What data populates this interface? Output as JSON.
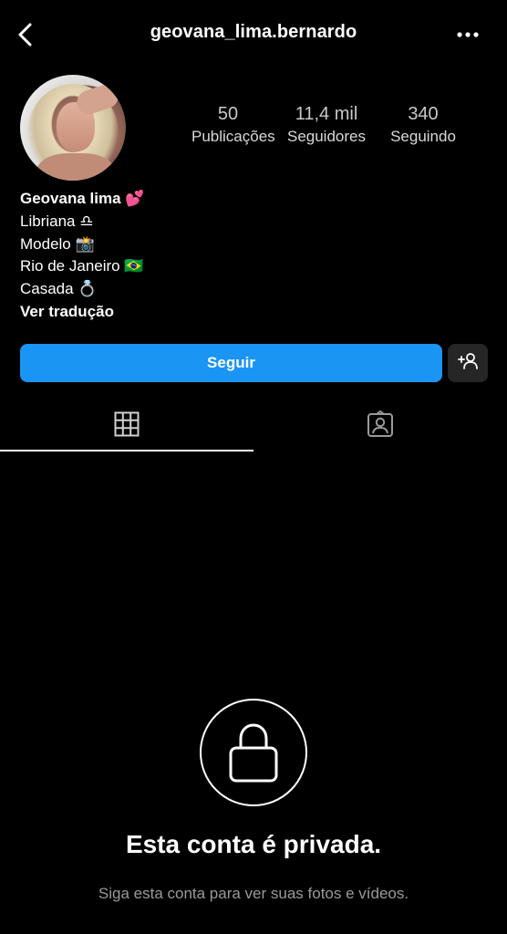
{
  "header": {
    "username": "geovana_lima.bernardo",
    "back_icon": "chevron-left-icon",
    "more_icon": "more-horizontal-icon"
  },
  "profile": {
    "stats": [
      {
        "value": "50",
        "label": "Publicações"
      },
      {
        "value": "11,4 mil",
        "label": "Seguidores"
      },
      {
        "value": "340",
        "label": "Seguindo"
      }
    ],
    "bio": {
      "name": "Geovana lima 💕",
      "lines": [
        "Libriana ♎",
        "Modelo 📸",
        "Rio de Janeiro 🇧🇷",
        "Casada 💍"
      ],
      "translate": "Ver tradução"
    }
  },
  "actions": {
    "follow_label": "Seguir",
    "suggest_icon": "add-person-icon"
  },
  "tabs": [
    {
      "name": "grid",
      "icon": "grid-icon",
      "selected": true
    },
    {
      "name": "tagged",
      "icon": "tagged-person-icon",
      "selected": false
    }
  ],
  "private_notice": {
    "icon": "lock-icon",
    "title": "Esta conta é privada.",
    "subtitle": "Siga esta conta para ver suas fotos e vídeos."
  },
  "colors": {
    "background": "#000000",
    "follow_button": "#1a95f3",
    "secondary_button": "#262626",
    "muted_text": "#9a9a9a"
  }
}
